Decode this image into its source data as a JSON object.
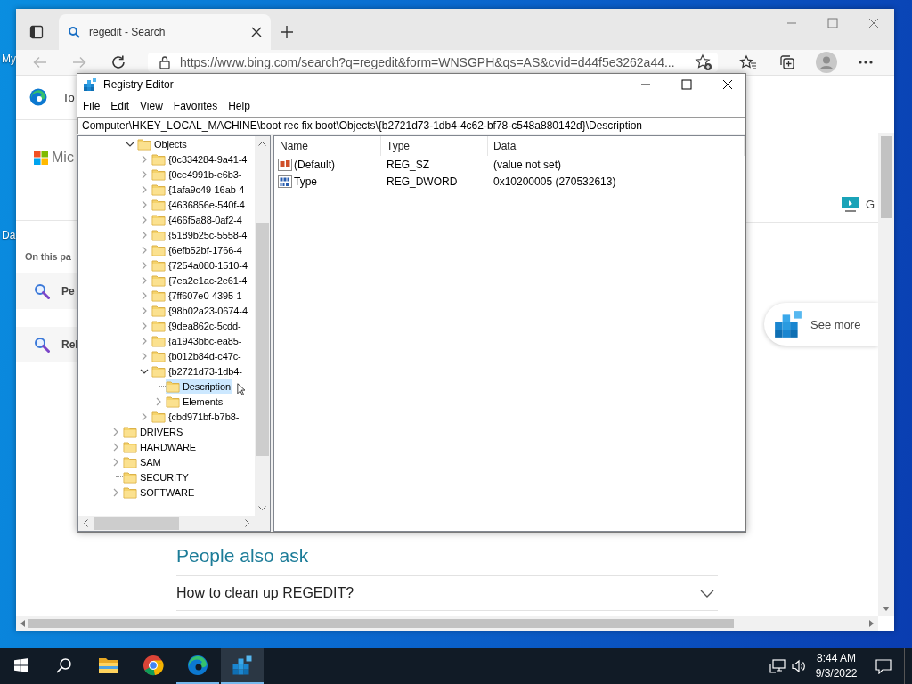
{
  "desktop": {
    "icon_labels": [
      "My",
      "Da"
    ]
  },
  "browser": {
    "tab": {
      "title": "regedit - Search",
      "selected": true
    },
    "url": "https://www.bing.com/search?q=regedit&form=WNSGPH&qs=AS&cvid=d44f5e3262a44...",
    "page": {
      "banner_text": "To",
      "brand_text": "Mic",
      "section_heading": "On this pa",
      "section_links": [
        "Pe",
        "Rel"
      ],
      "side_link": "G",
      "see_more": "See more",
      "people_also_ask": {
        "heading": "People also ask",
        "questions": [
          {
            "text": "How to clean up REGEDIT?",
            "expanded": false
          }
        ]
      }
    }
  },
  "registry_editor": {
    "title": "Registry Editor",
    "menu": [
      "File",
      "Edit",
      "View",
      "Favorites",
      "Help"
    ],
    "address": "Computer\\HKEY_LOCAL_MACHINE\\boot rec fix boot\\Objects\\{b2721d73-1db4-4c62-bf78-c548a880142d}\\Description",
    "tree": {
      "branch": {
        "label": "Objects",
        "kind": "branch",
        "expanded": true,
        "selected": false,
        "children": [
          {
            "label": "{0c334284-9a41-4",
            "kind": "branch",
            "expanded": false,
            "selected": false
          },
          {
            "label": "{0ce4991b-e6b3-",
            "kind": "branch",
            "expanded": false,
            "selected": false
          },
          {
            "label": "{1afa9c49-16ab-4",
            "kind": "branch",
            "expanded": false,
            "selected": false
          },
          {
            "label": "{4636856e-540f-4",
            "kind": "branch",
            "expanded": false,
            "selected": false
          },
          {
            "label": "{466f5a88-0af2-4",
            "kind": "branch",
            "expanded": false,
            "selected": false
          },
          {
            "label": "{5189b25c-5558-4",
            "kind": "branch",
            "expanded": false,
            "selected": false
          },
          {
            "label": "{6efb52bf-1766-4",
            "kind": "branch",
            "expanded": false,
            "selected": false
          },
          {
            "label": "{7254a080-1510-4",
            "kind": "branch",
            "expanded": false,
            "selected": false
          },
          {
            "label": "{7ea2e1ac-2e61-4",
            "kind": "branch",
            "expanded": false,
            "selected": false
          },
          {
            "label": "{7ff607e0-4395-1",
            "kind": "branch",
            "expanded": false,
            "selected": false
          },
          {
            "label": "{98b02a23-0674-4",
            "kind": "branch",
            "expanded": false,
            "selected": false
          },
          {
            "label": "{9dea862c-5cdd-",
            "kind": "branch",
            "expanded": false,
            "selected": false
          },
          {
            "label": "{a1943bbc-ea85-",
            "kind": "branch",
            "expanded": false,
            "selected": false
          },
          {
            "label": "{b012b84d-c47c-",
            "kind": "branch",
            "expanded": false,
            "selected": false
          },
          {
            "label": "{b2721d73-1db4-",
            "kind": "branch",
            "expanded": true,
            "selected": false,
            "children": [
              {
                "label": "Description",
                "kind": "leaf",
                "selected": true
              },
              {
                "label": "Elements",
                "kind": "branch",
                "expanded": false,
                "selected": false
              }
            ]
          },
          {
            "label": "{cbd971bf-b7b8-",
            "kind": "branch",
            "expanded": false,
            "selected": false
          }
        ]
      },
      "items": [
        {
          "label": "DRIVERS",
          "kind": "branch",
          "expanded": false,
          "selected": false
        },
        {
          "label": "HARDWARE",
          "kind": "branch",
          "expanded": false,
          "selected": false
        },
        {
          "label": "SAM",
          "kind": "branch",
          "expanded": false,
          "selected": false
        },
        {
          "label": "SECURITY",
          "kind": "leaf",
          "selected": false
        },
        {
          "label": "SOFTWARE",
          "kind": "branch",
          "expanded": false,
          "selected": false
        }
      ]
    },
    "values": {
      "columns": [
        "Name",
        "Type",
        "Data"
      ],
      "rows": [
        {
          "kind": "string",
          "name": "(Default)",
          "type": "REG_SZ",
          "data": "(value not set)"
        },
        {
          "kind": "dword",
          "name": "Type",
          "type": "REG_DWORD",
          "data": "0x10200005 (270532613)"
        }
      ]
    }
  },
  "taskbar": {
    "apps": [
      {
        "kind": "explorer",
        "running": false,
        "active": false
      },
      {
        "kind": "chrome",
        "running": false,
        "active": false
      },
      {
        "kind": "edge",
        "running": true,
        "active": false
      },
      {
        "kind": "regedit",
        "running": true,
        "active": true
      }
    ],
    "time": "8:44 AM",
    "date": "9/3/2022"
  }
}
